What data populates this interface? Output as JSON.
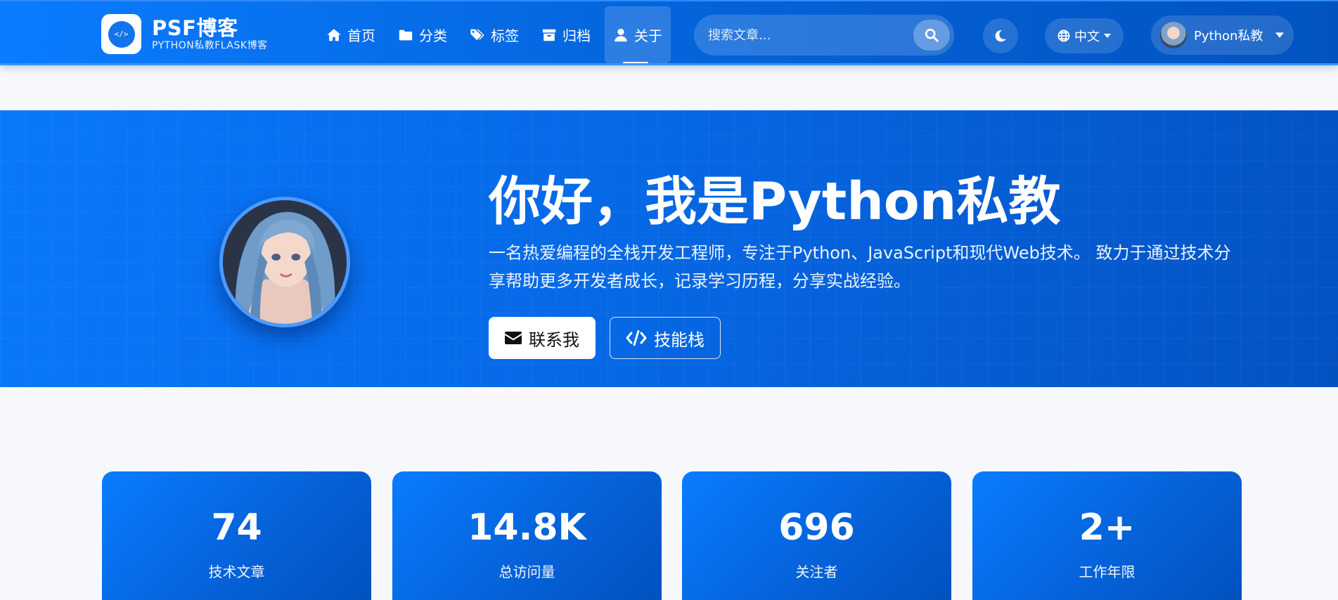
{
  "brand": {
    "logo_glyph": "</>",
    "title": "PSF博客",
    "subtitle": "PYTHON私教FLASK博客"
  },
  "nav": {
    "items": [
      {
        "label": "首页",
        "icon": "home-icon"
      },
      {
        "label": "分类",
        "icon": "folder-icon"
      },
      {
        "label": "标签",
        "icon": "tags-icon"
      },
      {
        "label": "归档",
        "icon": "archive-icon"
      },
      {
        "label": "关于",
        "icon": "user-icon",
        "active": true
      }
    ]
  },
  "search": {
    "placeholder": "搜索文章..."
  },
  "lang": {
    "label": "中文"
  },
  "user": {
    "name": "Python私教"
  },
  "hero": {
    "title": "你好，我是Python私教",
    "description": "一名热爱编程的全栈开发工程师，专注于Python、JavaScript和现代Web技术。 致力于通过技术分享帮助更多开发者成长，记录学习历程，分享实战经验。",
    "contact_label": "联系我",
    "skills_label": "技能栈"
  },
  "stats": [
    {
      "value": "74",
      "label": "技术文章"
    },
    {
      "value": "14.8K",
      "label": "总访问量"
    },
    {
      "value": "696",
      "label": "关注者"
    },
    {
      "value": "2+",
      "label": "工作年限"
    }
  ],
  "colors": {
    "primary": "#0a7cff",
    "primary_dark": "#0250bd",
    "page_bg": "#f6f8fb"
  }
}
